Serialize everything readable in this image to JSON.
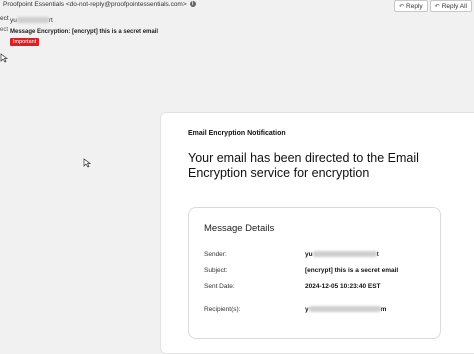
{
  "email_header": {
    "from_display": "Proofpoint Essentials <do-not-reply@proofpointessentials.com>",
    "to_prefix": "ect",
    "to_visible_start": "yu",
    "to_visible_end": "rt",
    "subject_prefix": "ect",
    "subject": "Message Encryption: [encrypt] this is a secret email",
    "badge": "Important"
  },
  "actions": {
    "reply_label": "Reply",
    "reply_all_label": "Reply All"
  },
  "notification": {
    "heading": "Email Encryption Notification",
    "title": "Your email has been directed to the Email Encryption service for encryption",
    "details_title": "Message Details",
    "rows": [
      {
        "label": "Sender:",
        "value_start": "yu",
        "value_end": "t"
      },
      {
        "label": "Subject:",
        "value": "[encrypt] this is a secret email"
      },
      {
        "label": "Sent Date:",
        "value": "2024-12-05 10:23:40 EST"
      },
      {
        "label": "Recipient(s):",
        "value_start": "y",
        "value_end": "m"
      }
    ]
  }
}
